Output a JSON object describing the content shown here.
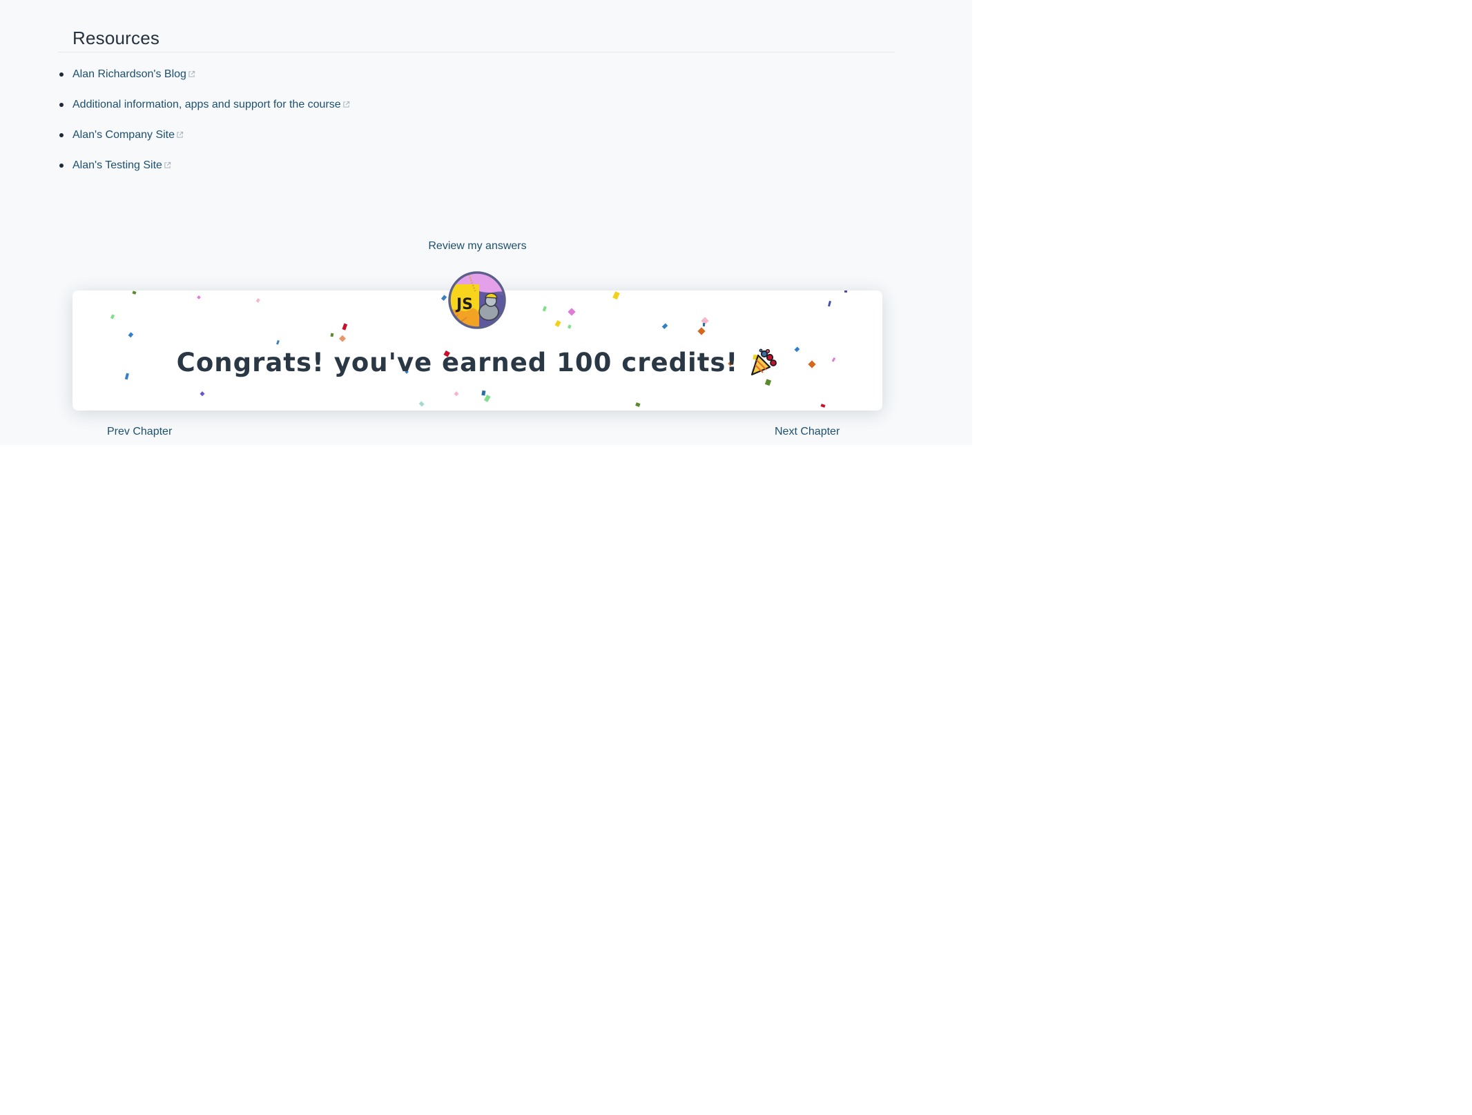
{
  "resources": {
    "heading": "Resources",
    "links": [
      {
        "label": "Alan Richardson's Blog",
        "icon": "external-link-icon"
      },
      {
        "label": "Additional information, apps and support for the course",
        "icon": "external-link-icon"
      },
      {
        "label": "Alan's Company Site",
        "icon": "external-link-icon"
      },
      {
        "label": "Alan's Testing Site",
        "icon": "external-link-icon"
      }
    ]
  },
  "review": {
    "label": "Review my answers"
  },
  "congrats": {
    "message": "Congrats! you've earned 100 credits!",
    "badge_text": "JS",
    "badge_icon": "javascript-badge-icon",
    "celebration_icon": "party-popper-icon",
    "confetti_icon": "confetti-icon"
  },
  "navigation": {
    "prev_label": "Prev Chapter",
    "next_label": "Next Chapter"
  },
  "colors": {
    "link": "#1d4f6e",
    "text": "#27323f",
    "panel_background": "#f7f9fb",
    "card_background": "#ffffff",
    "badge_yellow": "#f7d51d",
    "badge_ring": "#5a5f8c"
  }
}
